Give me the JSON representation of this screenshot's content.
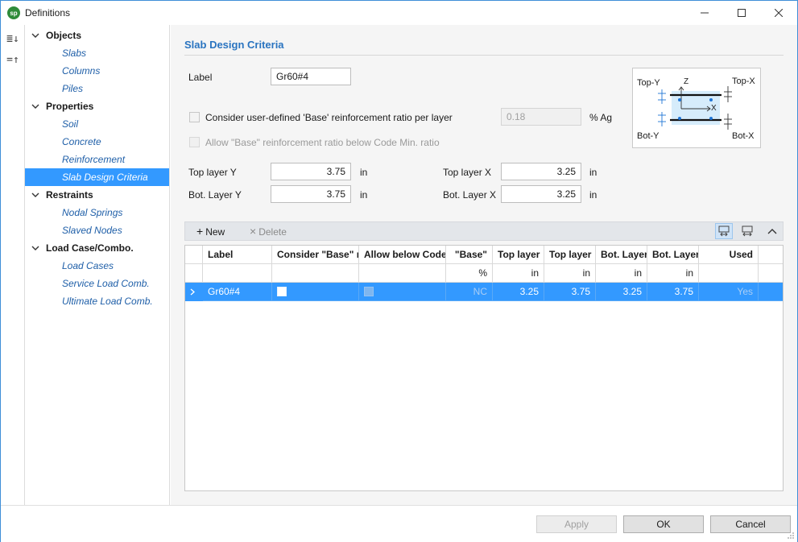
{
  "window": {
    "title": "Definitions",
    "logo": "sp",
    "colors": {
      "accent": "#3399ff",
      "heading": "#2a74c0",
      "tree_link": "#1f5fa8"
    }
  },
  "left_strip": {
    "expand_all_icon": "≣↓",
    "collapse_all_icon": "=↑"
  },
  "tree": {
    "groups": [
      {
        "label": "Objects",
        "children": [
          "Slabs",
          "Columns",
          "Piles"
        ]
      },
      {
        "label": "Properties",
        "children": [
          "Soil",
          "Concrete",
          "Reinforcement",
          "Slab Design Criteria"
        ]
      },
      {
        "label": "Restraints",
        "children": [
          "Nodal Springs",
          "Slaved Nodes"
        ]
      },
      {
        "label": "Load Case/Combo.",
        "children": [
          "Load Cases",
          "Service Load Comb.",
          "Ultimate Load Comb."
        ]
      }
    ],
    "selected": "Slab Design Criteria"
  },
  "main": {
    "section_title": "Slab Design Criteria",
    "label_caption": "Label",
    "label_value": "Gr60#4",
    "consider_base_text": "Consider user-defined 'Base' reinforcement ratio per layer",
    "base_ratio_value": "0.18",
    "base_ratio_unit": "% Ag",
    "allow_base_text": "Allow \"Base\" reinforcement ratio below Code Min. ratio",
    "top_layer_y": {
      "label": "Top layer Y",
      "value": "3.75",
      "unit": "in"
    },
    "bot_layer_y": {
      "label": "Bot. Layer Y",
      "value": "3.75",
      "unit": "in"
    },
    "top_layer_x": {
      "label": "Top layer X",
      "value": "3.25",
      "unit": "in"
    },
    "bot_layer_x": {
      "label": "Bot. Layer X",
      "value": "3.25",
      "unit": "in"
    },
    "diagram": {
      "top_y": "Top-Y",
      "top_x": "Top-X",
      "bot_y": "Bot-Y",
      "bot_x": "Bot-X",
      "axis_z": "Z",
      "axis_x": "X"
    }
  },
  "grid_toolbar": {
    "new_label": "New",
    "delete_label": "Delete"
  },
  "grid": {
    "headers": [
      "Label",
      "Consider \"Base\" r",
      "Allow below Code",
      "\"Base\"",
      "Top layer",
      "Top layer",
      "Bot. Layer",
      "Bot. Layer",
      "Used"
    ],
    "units": [
      "",
      "",
      "",
      "%",
      "in",
      "in",
      "in",
      "in",
      ""
    ],
    "rows": [
      {
        "label": "Gr60#4",
        "consider": false,
        "allow": false,
        "base": "NC",
        "top_y": "3.25",
        "top_x": "3.75",
        "bot_y": "3.25",
        "bot_x": "3.75",
        "used": "Yes"
      }
    ]
  },
  "footer": {
    "apply": "Apply",
    "ok": "OK",
    "cancel": "Cancel"
  }
}
